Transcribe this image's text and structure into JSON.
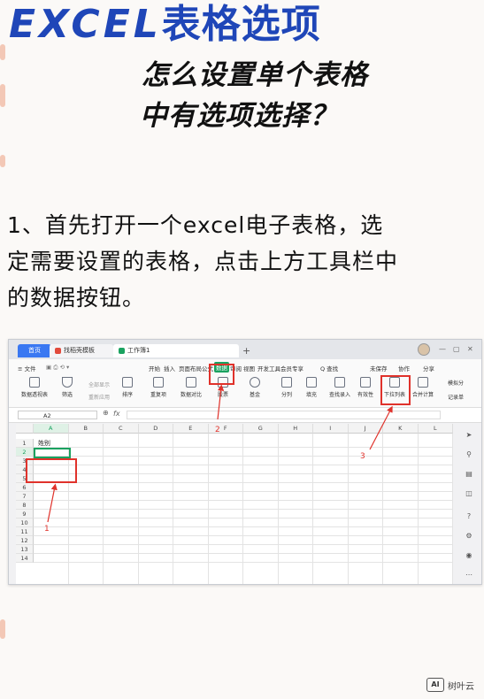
{
  "heading": {
    "title_en": "EXCEL",
    "title_cn": "表格选项",
    "subtitle_line1": "怎么设置单个表格",
    "subtitle_line2": "中有选项选择？"
  },
  "step1": {
    "line1": "1、首先打开一个excel电子表格，选",
    "line2": "定需要设置的表格，点击上方工具栏中",
    "line3": "的数据按钮。"
  },
  "screenshot": {
    "tabs": {
      "home": "首页",
      "template": "找稻壳模板",
      "workbook": "工作簿1",
      "add": "+"
    },
    "menu": {
      "file": "≡ 文件",
      "start": "开始",
      "insert": "插入",
      "layout": "页面布局",
      "formula": "公式",
      "data": "数据",
      "review": "审阅",
      "view": "视图",
      "dev": "开发工具",
      "member": "会员专享",
      "search": "Q 查找",
      "unsaved": "未保存",
      "collab": "协作",
      "share": "分享"
    },
    "toolbar": {
      "pivot": "数据透视表",
      "filter": "筛选",
      "show_all": "全部显示",
      "reapply": "重新应用",
      "sort": "排序",
      "duplicate": "重复项",
      "compare": "数据对比",
      "extract": "股票",
      "fill": "基金",
      "split": "分列",
      "fill2": "填充",
      "lookup": "查找录入",
      "validity": "有效性",
      "dropdown": "下拉列表",
      "merge_calc": "合并计算",
      "simulate": "模拟分",
      "record": "记录单"
    },
    "formula_bar": {
      "cell_ref": "A2",
      "fx": "fx"
    },
    "columns": [
      "A",
      "B",
      "C",
      "D",
      "E",
      "F",
      "G",
      "H",
      "I",
      "J",
      "K",
      "L"
    ],
    "rows": [
      "1",
      "2",
      "3",
      "4",
      "5",
      "6",
      "7",
      "8",
      "9",
      "10",
      "11",
      "12",
      "13",
      "14"
    ],
    "cell_a1": "姓别",
    "annotations": {
      "n1": "1",
      "n2": "2",
      "n3": "3"
    },
    "accent_green": "#1aa260",
    "annotation_red": "#e0322b"
  },
  "watermark": {
    "badge": "AI",
    "text": "树叶云"
  }
}
